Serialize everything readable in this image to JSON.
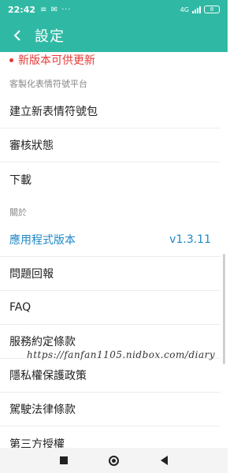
{
  "status_bar": {
    "time": "22:42",
    "icons": "≡ ✉ ···",
    "network": "4G",
    "battery": "8"
  },
  "app_bar": {
    "title": "設定"
  },
  "update_notice": "新版本可供更新",
  "sections": [
    {
      "header": "客製化表情符號平台",
      "items": [
        {
          "label": "建立新表情符號包"
        },
        {
          "label": "審核狀態"
        },
        {
          "label": "下載"
        }
      ]
    },
    {
      "header": "關於",
      "items": [
        {
          "label": "應用程式版本",
          "value": "v1.3.11"
        },
        {
          "label": "問題回報"
        },
        {
          "label": "FAQ"
        },
        {
          "label": "服務約定條款"
        },
        {
          "label": "隱私權保護政策"
        },
        {
          "label": "駕駛法律條款"
        },
        {
          "label": "第三方授權"
        }
      ]
    }
  ],
  "watermark": "https://fanfan1105.nidbox.com/diary",
  "colors": {
    "accent": "#2fb9a4",
    "link": "#1e88c7",
    "alert": "#e53935"
  }
}
